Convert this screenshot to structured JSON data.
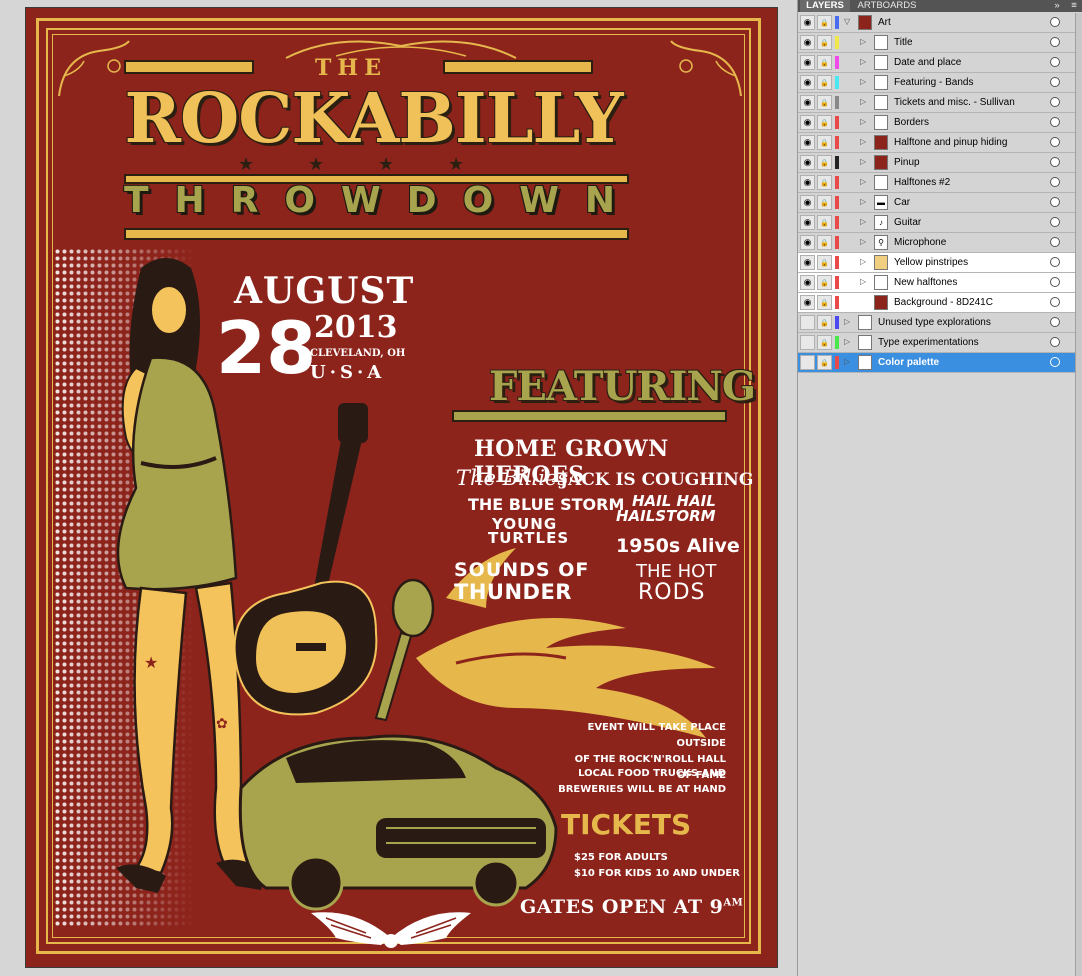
{
  "poster": {
    "title_the": "THE",
    "title_main": "ROCKABILLY",
    "title_sub": "THROWDOWN",
    "date_month": "AUGUST",
    "date_day": "28",
    "date_year": "2013",
    "date_city": "CLEVELAND, OH",
    "date_country": "U·S·A",
    "featuring_heading": "FEATURING",
    "bands": [
      "HOME GROWN HEROES",
      "The Billies",
      "JACK IS COUGHING",
      "THE BLUE STORM",
      "HAIL HAIL",
      "HAILSTORM",
      "YOUNG",
      "TURTLES",
      "1950s Alive",
      "SOUNDS OF",
      "THUNDER",
      "THE HOT",
      "RODS"
    ],
    "event_info": [
      "EVENT WILL TAKE PLACE OUTSIDE",
      "OF THE ROCK'N'ROLL HALL OF FAME"
    ],
    "food_info": [
      "LOCAL FOOD TRUCKS AND",
      "BREWERIES WILL BE AT HAND"
    ],
    "tickets_heading": "TICKETS",
    "ticket_prices": [
      "$25 FOR ADULTS",
      "$10 FOR KIDS 10 AND UNDER"
    ],
    "gates": "GATES OPEN AT 9",
    "gates_suffix": "AM",
    "colors": {
      "background": "#8d241c",
      "gold": "#e6b84c",
      "olive": "#a8a44e",
      "ink": "#2b1f12"
    }
  },
  "panel": {
    "tabs": [
      "LAYERS",
      "ARTBOARDS"
    ],
    "layers": [
      {
        "name": "Art",
        "depth": 0,
        "expanded": true,
        "color": "#4a6cf0",
        "visible": true,
        "thumb": "art"
      },
      {
        "name": "Title",
        "depth": 1,
        "color": "#f0e84a",
        "visible": true,
        "thumb": "title"
      },
      {
        "name": "Date and place",
        "depth": 1,
        "color": "#f04ae8",
        "visible": true,
        "thumb": "blank"
      },
      {
        "name": "Featuring - Bands",
        "depth": 1,
        "color": "#4ae8f0",
        "visible": true,
        "thumb": "blank"
      },
      {
        "name": "Tickets and misc. - Sullivan",
        "depth": 1,
        "color": "#888888",
        "visible": true,
        "thumb": "tickets"
      },
      {
        "name": "Borders",
        "depth": 1,
        "color": "#e84a4a",
        "visible": true,
        "thumb": "blank"
      },
      {
        "name": "Halftone and pinup hiding",
        "depth": 1,
        "color": "#e84a4a",
        "visible": true,
        "thumb": "halftone"
      },
      {
        "name": "Pinup",
        "depth": 1,
        "color": "#222222",
        "visible": true,
        "thumb": "pinup"
      },
      {
        "name": "Halftones #2",
        "depth": 1,
        "color": "#e84a4a",
        "visible": true,
        "thumb": "blank"
      },
      {
        "name": "Car",
        "depth": 1,
        "color": "#e84a4a",
        "visible": true,
        "thumb": "car"
      },
      {
        "name": "Guitar",
        "depth": 1,
        "color": "#e84a4a",
        "visible": true,
        "thumb": "guitar"
      },
      {
        "name": "Microphone",
        "depth": 1,
        "color": "#e84a4a",
        "visible": true,
        "thumb": "mic"
      },
      {
        "name": "Yellow pinstripes",
        "depth": 1,
        "color": "#e84a4a",
        "visible": true,
        "thumb": "stripes",
        "white": true
      },
      {
        "name": "New halftones",
        "depth": 1,
        "color": "#e84a4a",
        "visible": true,
        "thumb": "blank",
        "white": true
      },
      {
        "name": "Background - 8D241C",
        "depth": 1,
        "color": "#e84a4a",
        "visible": true,
        "thumb": "bg",
        "white": true,
        "noexpand": true
      },
      {
        "name": "Unused type explorations",
        "depth": 0,
        "color": "#4a4af0",
        "visible": false,
        "thumb": "type"
      },
      {
        "name": "Type experimentations",
        "depth": 0,
        "color": "#4ae84a",
        "visible": false,
        "thumb": "type2"
      },
      {
        "name": "Color palette",
        "depth": 0,
        "color": "#e84a4a",
        "visible": false,
        "thumb": "palette",
        "selected": true
      }
    ]
  }
}
